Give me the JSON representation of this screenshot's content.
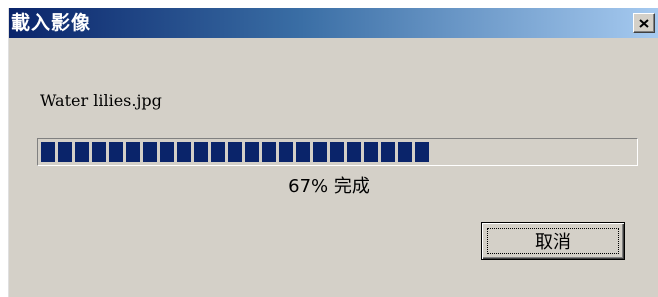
{
  "dialog": {
    "title": "載入影像",
    "filename": "Water lilies.jpg",
    "progress_fraction": 0.67,
    "status_text": "67% 完成",
    "cancel_label": "取消"
  },
  "colors": {
    "titlebar_start": "#0a246a",
    "titlebar_end": "#a6caf0",
    "progress_block": "#0a246a",
    "dialog_background": "#d4d0c8"
  },
  "icons": {
    "close": "close-icon"
  }
}
